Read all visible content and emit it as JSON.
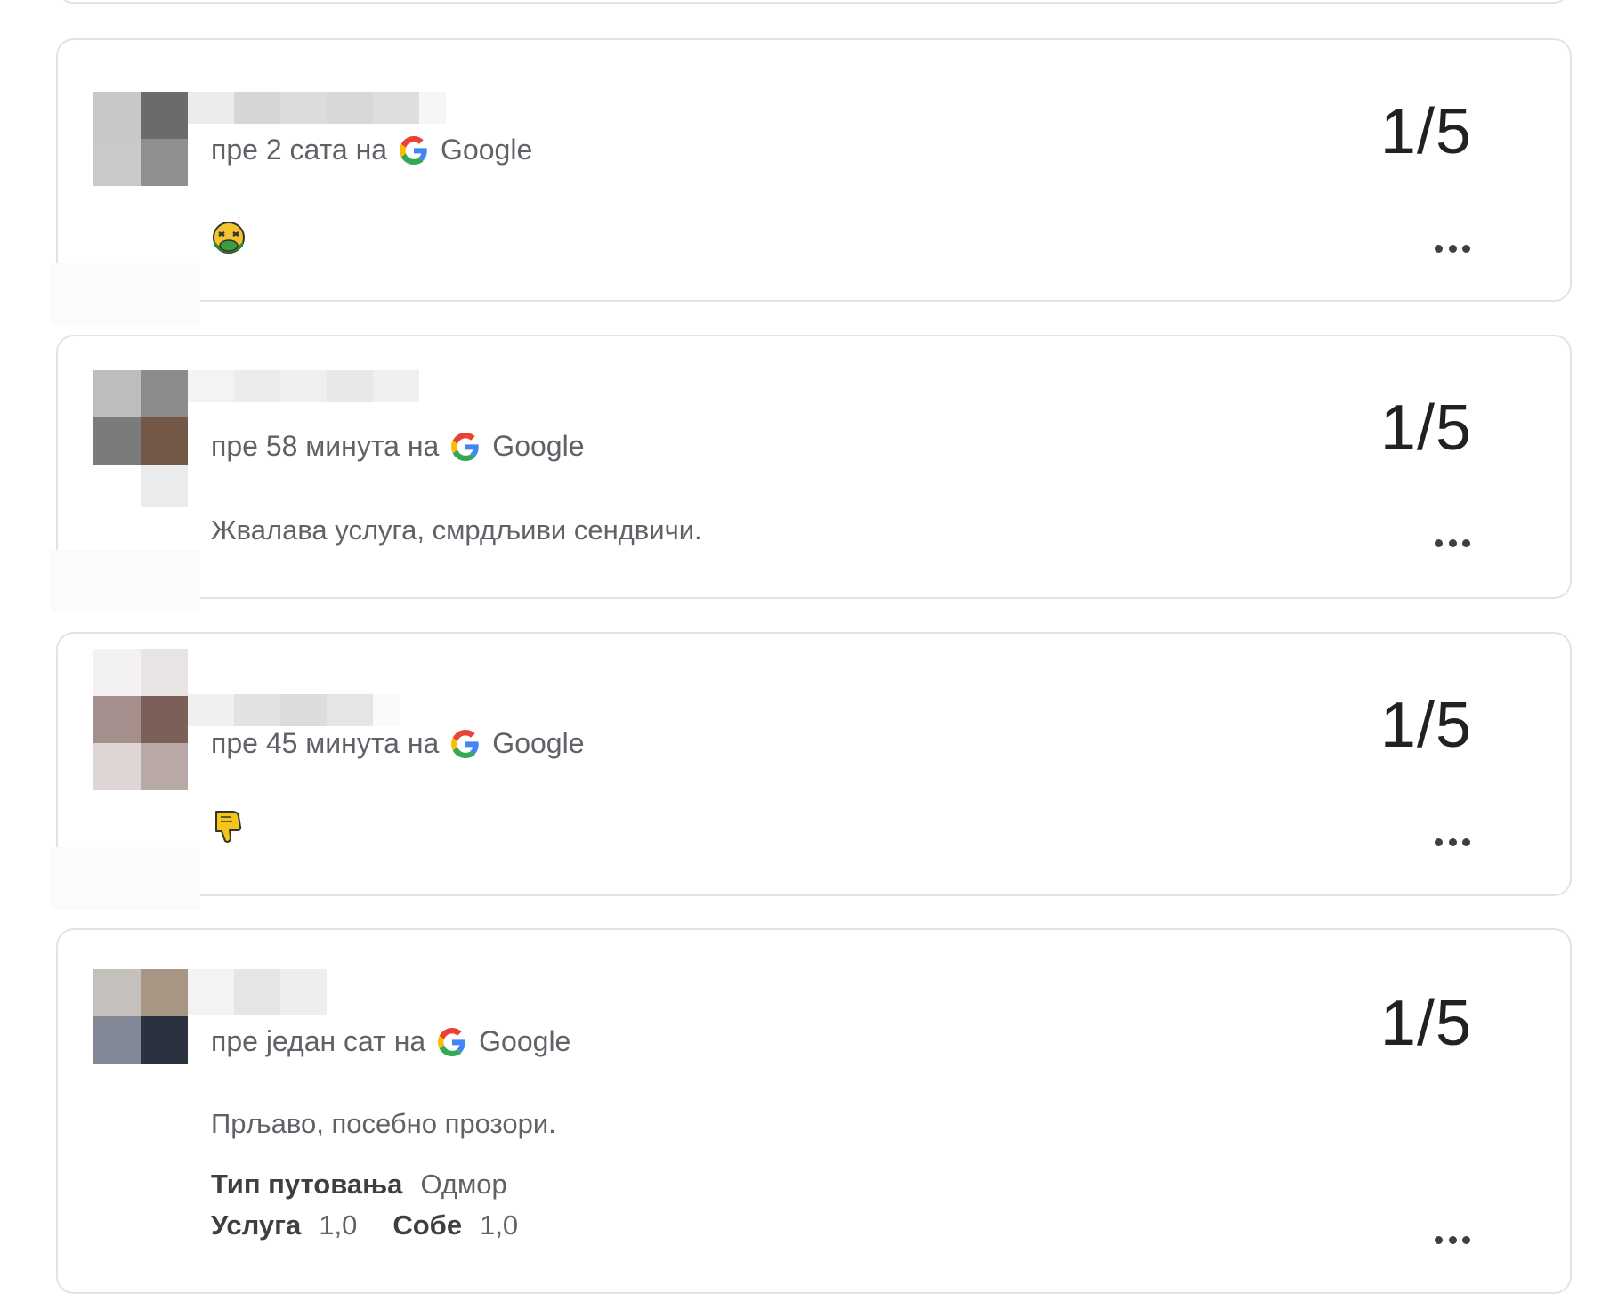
{
  "reviews": [
    {
      "time": "пре 2 сата на",
      "source": "Google",
      "rating": "1/5",
      "text": "",
      "emoji": "nauseated-face-icon"
    },
    {
      "time": "пре 58 минута на",
      "source": "Google",
      "rating": "1/5",
      "text": "Жвалава услуга, смрдљиви сендвичи."
    },
    {
      "time": "пре 45 минута на",
      "source": "Google",
      "rating": "1/5",
      "text": "",
      "emoji": "thumbs-down-icon"
    },
    {
      "time": "пре један сат на",
      "source": "Google",
      "rating": "1/5",
      "text": "Прљаво, посебно прозори.",
      "trip_type_label": "Тип путовања",
      "trip_type_value": "Одмор",
      "service_label": "Услуга",
      "service_value": "1,0",
      "rooms_label": "Собе",
      "rooms_value": "1,0"
    }
  ],
  "colors": {
    "card_border": "#e3e3e3",
    "rating_text": "#202124",
    "meta_text": "#5f6368"
  }
}
